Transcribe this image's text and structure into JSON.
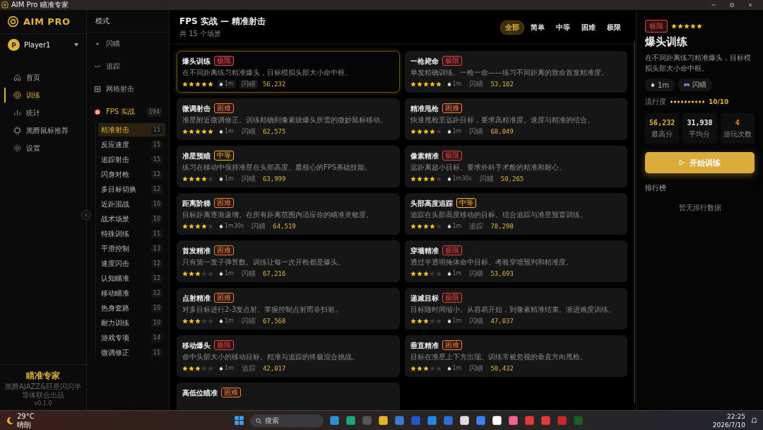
{
  "window": {
    "title": "AIM Pro 瞄准专家"
  },
  "sidebar": {
    "logo": "AIM PRO",
    "user": {
      "initial": "P",
      "name": "Player1"
    },
    "items": [
      {
        "label": "首页",
        "selected": false
      },
      {
        "label": "训练",
        "selected": true
      },
      {
        "label": "统计",
        "selected": false
      },
      {
        "label": "黑爵鼠标推荐",
        "selected": false
      },
      {
        "label": "设置",
        "selected": false
      }
    ],
    "footer": {
      "title": "瞄准专家",
      "credit": "黑爵AJAZZ&巨星闪闪半导体联合出品",
      "version": "v0.1.0"
    }
  },
  "modes": {
    "header": "模式",
    "items": [
      {
        "label": "闪瞄",
        "selected": false
      },
      {
        "label": "追踪",
        "selected": false
      },
      {
        "label": "网格射击",
        "selected": false
      },
      {
        "label": "FPS 实战",
        "selected": true,
        "count": "194",
        "expanded": true,
        "children": [
          {
            "label": "精准射击",
            "count": "15",
            "selected": true
          },
          {
            "label": "反应速度",
            "count": "15",
            "selected": false
          },
          {
            "label": "追踪射击",
            "count": "15",
            "selected": false
          },
          {
            "label": "闪身对枪",
            "count": "12",
            "selected": false
          },
          {
            "label": "多目标切换",
            "count": "12",
            "selected": false
          },
          {
            "label": "近距混战",
            "count": "10",
            "selected": false
          },
          {
            "label": "战术场景",
            "count": "10",
            "selected": false
          },
          {
            "label": "特殊训练",
            "count": "11",
            "selected": false
          },
          {
            "label": "平滑控制",
            "count": "13",
            "selected": false
          },
          {
            "label": "速度闪击",
            "count": "12",
            "selected": false
          },
          {
            "label": "认知瞄准",
            "count": "12",
            "selected": false
          },
          {
            "label": "移动瞄准",
            "count": "12",
            "selected": false
          },
          {
            "label": "热身套路",
            "count": "10",
            "selected": false
          },
          {
            "label": "耐力训练",
            "count": "10",
            "selected": false
          },
          {
            "label": "游戏专项",
            "count": "14",
            "selected": false
          },
          {
            "label": "微调修正",
            "count": "11",
            "selected": false
          }
        ]
      }
    ]
  },
  "main": {
    "title": "FPS 实战 — 精准射击",
    "subtitle": "共 15 个场景",
    "filters": [
      {
        "label": "全部",
        "selected": true
      },
      {
        "label": "简单",
        "selected": false
      },
      {
        "label": "中等",
        "selected": false
      },
      {
        "label": "困难",
        "selected": false
      },
      {
        "label": "极限",
        "selected": false
      }
    ],
    "cards": [
      {
        "title": "爆头训练",
        "difficulty": "极限",
        "color": "#e04545",
        "desc": "在不同距离练习精准爆头，目标模拟头部大小命中框。",
        "stars": 5,
        "time": "1m",
        "mode": "闪瞄",
        "score": "56,232",
        "selected": true
      },
      {
        "title": "一枪毙命",
        "difficulty": "极限",
        "color": "#e04545",
        "desc": "单发精确训练。一枪一命——练习不同距离的致命首发精准度。",
        "stars": 5,
        "time": "1m",
        "mode": "闪瞄",
        "score": "53,102",
        "selected": false
      },
      {
        "title": "微调射击",
        "difficulty": "困难",
        "color": "#e8843a",
        "desc": "准星附近微调修正。训练精确到像素级爆头所需的微妙鼠标移动。",
        "stars": 5,
        "time": "1m",
        "mode": "闪瞄",
        "score": "62,575",
        "selected": false
      },
      {
        "title": "精准甩枪",
        "difficulty": "困难",
        "color": "#e8843a",
        "desc": "快速甩枪至远距目标，要求高精准度。速度与精准的结合。",
        "stars": 4,
        "time": "1m",
        "mode": "闪瞄",
        "score": "68,049",
        "selected": false
      },
      {
        "title": "准星预瞄",
        "difficulty": "中等",
        "color": "#e6c02a",
        "desc": "练习在移动中保持准星在头部高度。最核心的FPS基础技能。",
        "stars": 4,
        "time": "1m",
        "mode": "闪瞄",
        "score": "63,999",
        "selected": false
      },
      {
        "title": "像素精准",
        "difficulty": "极限",
        "color": "#e04545",
        "desc": "远距离超小目标。要求外科手术般的精准和耐心。",
        "stars": 4,
        "time": "1m30s",
        "mode": "闪瞄",
        "score": "50,265",
        "selected": false
      },
      {
        "title": "距离阶梯",
        "difficulty": "困难",
        "color": "#e8843a",
        "desc": "目标距离逐渐递增。在所有距离范围内适应你的瞄准灵敏度。",
        "stars": 4,
        "time": "1m30s",
        "mode": "闪瞄",
        "score": "64,519",
        "selected": false
      },
      {
        "title": "头部高度追踪",
        "difficulty": "中等",
        "color": "#e6c02a",
        "desc": "追踪在头部高度移动的目标。结合追踪与准星预置训练。",
        "stars": 4,
        "time": "1m",
        "mode": "追踪",
        "score": "78,298",
        "selected": false
      },
      {
        "title": "首发精准",
        "difficulty": "困难",
        "color": "#e8843a",
        "desc": "只有第一发子弹算数。训练让每一次开枪都是爆头。",
        "stars": 3,
        "time": "1m",
        "mode": "闪瞄",
        "score": "67,216",
        "selected": false
      },
      {
        "title": "穿墙精准",
        "difficulty": "极限",
        "color": "#e04545",
        "desc": "透过半透明掩体命中目标。考验穿墙预判和精准度。",
        "stars": 3,
        "time": "1m",
        "mode": "闪瞄",
        "score": "53,693",
        "selected": false
      },
      {
        "title": "点射精准",
        "difficulty": "困难",
        "color": "#e8843a",
        "desc": "对多目标进行2-3发点射。掌握控制点射而非扫射。",
        "stars": 3,
        "time": "1m",
        "mode": "闪瞄",
        "score": "67,568",
        "selected": false
      },
      {
        "title": "递减目标",
        "difficulty": "极限",
        "color": "#e04545",
        "desc": "目标随时间缩小。从容易开始，到像素精准结束。渐进难度训练。",
        "stars": 3,
        "time": "1m",
        "mode": "闪瞄",
        "score": "47,037",
        "selected": false
      },
      {
        "title": "移动爆头",
        "difficulty": "极限",
        "color": "#e04545",
        "desc": "命中头部大小的移动目标。精准与追踪的终极混合挑战。",
        "stars": 3,
        "time": "1m",
        "mode": "追踪",
        "score": "42,017",
        "selected": false
      },
      {
        "title": "垂直精准",
        "difficulty": "困难",
        "color": "#e8843a",
        "desc": "目标在准星上下方出现。训练常被忽视的垂直方向甩枪。",
        "stars": 3,
        "time": "1m",
        "mode": "闪瞄",
        "score": "50,432",
        "selected": false
      },
      {
        "title": "高低位瞄准",
        "difficulty": "困难",
        "color": "#e8843a",
        "selected": false
      }
    ]
  },
  "detail": {
    "difficulty": "极限",
    "color": "#e04545",
    "stars": 5,
    "title": "爆头训练",
    "desc": "在不同距离练习精准爆头，目标模拟头部大小命中框。",
    "time": "1m",
    "mode": "闪瞄",
    "popularity": {
      "label": "流行度",
      "level": 1,
      "reading": "10/10"
    },
    "stats": [
      {
        "value": "56,232",
        "label": "最高分",
        "kind": "best"
      },
      {
        "value": "31,938",
        "label": "平均分",
        "kind": "avg"
      },
      {
        "value": "4",
        "label": "游玩次数",
        "kind": "count"
      }
    ],
    "start": "开始训练",
    "leaderboard": "排行榜",
    "empty": "暂无排行数据"
  },
  "taskbar": {
    "temperature": "29°C",
    "weather": "晴朗",
    "search": {
      "placeholder": "搜索"
    },
    "time": "22:25",
    "date": "2026/7/10"
  }
}
